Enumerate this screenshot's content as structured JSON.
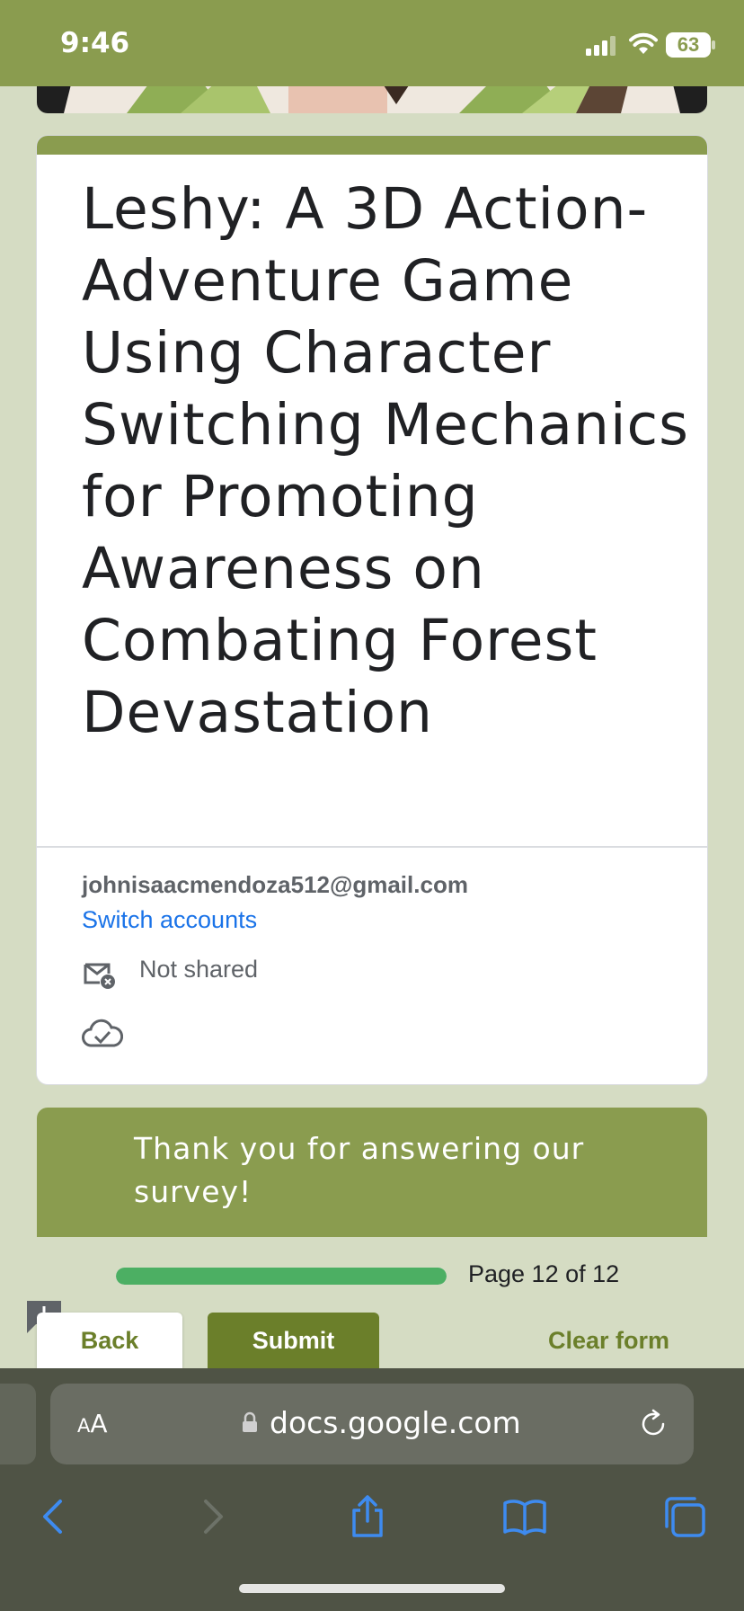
{
  "status_bar": {
    "time": "9:46",
    "battery": "63"
  },
  "form": {
    "title": "Leshy: A 3D Action-Adventure Game Using Character Switching Mechanics for Promoting Awareness on Combating Forest Devastation",
    "account_email": "johnisaacmendoza512@gmail.com",
    "switch_accounts": "Switch accounts",
    "email_status": "Not shared",
    "confirmation": "Thank you for answering our survey!"
  },
  "navigation": {
    "page_indicator": "Page 12 of 12",
    "progress": 1.0,
    "back_label": "Back",
    "submit_label": "Submit",
    "clear_label": "Clear form"
  },
  "browser": {
    "aa_small": "A",
    "aa_large": "A",
    "url": "docs.google.com"
  },
  "colors": {
    "theme": "#8a9c4f",
    "button": "#6b7f2a",
    "progress": "#4caf63",
    "link": "#1a73e8"
  },
  "icons": [
    "signal-icon",
    "wifi-icon",
    "battery-icon",
    "mail-x-icon",
    "cloud-check-icon",
    "feedback-icon",
    "lock-icon",
    "reload-icon",
    "back-arrow-icon",
    "forward-arrow-icon",
    "share-icon",
    "bookmarks-icon",
    "tabs-icon"
  ]
}
